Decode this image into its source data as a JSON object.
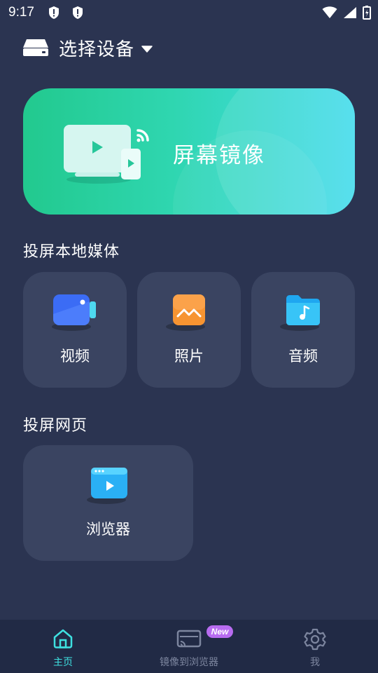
{
  "status_bar": {
    "time": "9:17",
    "left_icons": [
      "alert-shield-icon",
      "alert-shield-icon"
    ],
    "right_icons": [
      "wifi-icon",
      "signal-icon",
      "battery-icon"
    ]
  },
  "device_selector": {
    "icon": "device-box-icon",
    "label": "选择设备",
    "caret": "caret-down-icon"
  },
  "mirror_banner": {
    "label": "屏幕镜像",
    "icon": "screen-cast-illustration"
  },
  "local_media": {
    "title": "投屏本地媒体",
    "items": [
      {
        "label": "视频",
        "icon": "video-camera-icon",
        "color": "#3b6cf5"
      },
      {
        "label": "照片",
        "icon": "photo-icon",
        "color": "#f79431"
      },
      {
        "label": "音频",
        "icon": "music-folder-icon",
        "color": "#1fa7f0"
      }
    ]
  },
  "web_cast": {
    "title": "投屏网页",
    "items": [
      {
        "label": "浏览器",
        "icon": "browser-play-icon",
        "color": "#2ab0f5"
      }
    ]
  },
  "bottom_nav": {
    "items": [
      {
        "label": "主页",
        "icon": "home-icon",
        "active": true
      },
      {
        "label": "镜像到浏览器",
        "icon": "cast-screen-icon",
        "active": false,
        "badge": "New"
      },
      {
        "label": "我",
        "icon": "gear-icon",
        "active": false
      }
    ],
    "active_color": "#3ee0e0",
    "inactive_color": "#7d869f"
  },
  "colors": {
    "background": "#2b3451",
    "tile": "#3a4461",
    "nav_background": "#212a45",
    "badge": "#b86cf0"
  }
}
